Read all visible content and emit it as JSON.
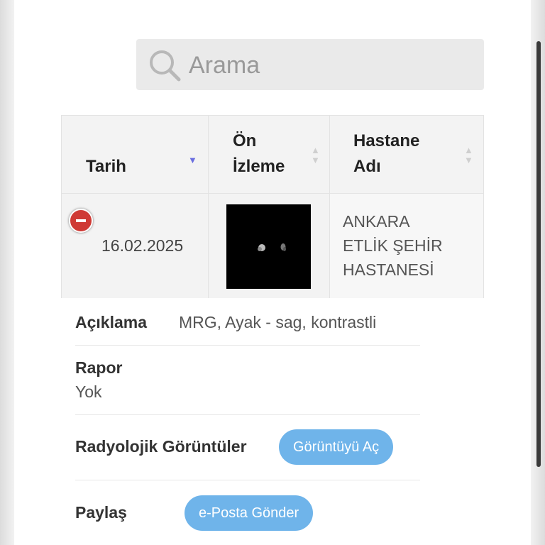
{
  "search": {
    "placeholder": "Arama"
  },
  "table": {
    "columns": [
      {
        "line1": "",
        "line2": "Tarih"
      },
      {
        "line1": "Ön",
        "line2": "İzleme"
      },
      {
        "line1": "Hastane",
        "line2": "Adı"
      }
    ],
    "rows": [
      {
        "date": "16.02.2025",
        "hospital_lines": [
          "ANKARA",
          "ETLİK ŞEHİR",
          "HASTANESİ"
        ]
      }
    ]
  },
  "details": {
    "description_label": "Açıklama",
    "description_value": "MRG, Ayak - sag, kontrastli",
    "report_label": "Rapor",
    "report_value": "Yok",
    "images_label": "Radyolojik Görüntüler",
    "images_button": "Görüntüyü Aç",
    "share_label": "Paylaş",
    "share_button": "e-Posta Gönder"
  },
  "colors": {
    "button": "#6fb4ea",
    "collapse": "#cf3a35",
    "sort_active": "#6a6ee0"
  }
}
